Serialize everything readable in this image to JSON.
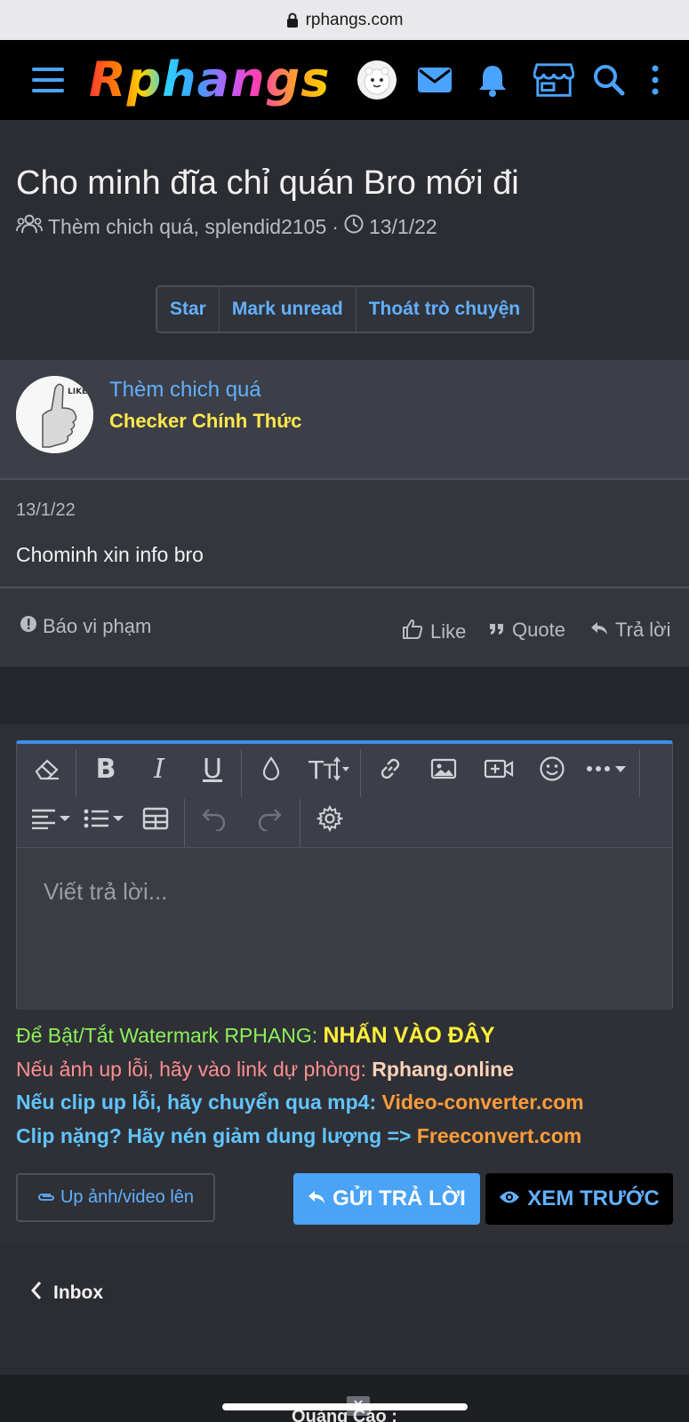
{
  "browser": {
    "url": "rphangs.com"
  },
  "header": {
    "logo_text": "Rphangs",
    "icons": [
      "menu-icon",
      "avatar",
      "mail-icon",
      "bell-icon",
      "store-icon",
      "search-icon",
      "more-vertical-icon"
    ],
    "accent_color": "#4aa3ff"
  },
  "thread": {
    "title": "Cho minh đĩa chỉ quán Bro mới đi",
    "participants": "Thèm chich quá, splendid2105",
    "separator": "·",
    "date": "13/1/22",
    "buttons": {
      "star": "Star",
      "mark_unread": "Mark unread",
      "leave": "Thoát trò chuyện"
    }
  },
  "post": {
    "username": "Thèm chich quá",
    "user_title": "Checker Chính Thức",
    "avatar_text": "LIKE",
    "date": "13/1/22",
    "body": "Chominh xin info bro",
    "report": "Báo vi phạm",
    "like": "Like",
    "quote": "Quote",
    "reply": "Trả lời"
  },
  "editor": {
    "placeholder": "Viết trả lời...",
    "toolbar_row1": [
      "eraser-icon",
      "bold-icon",
      "italic-icon",
      "underline-icon",
      "color-drop-icon",
      "text-size-icon",
      "link-icon",
      "image-icon",
      "video-icon",
      "smiley-icon",
      "more-icon"
    ],
    "toolbar_row2": [
      "align-icon",
      "list-icon",
      "table-icon",
      "undo-icon",
      "redo-icon",
      "settings-icon"
    ]
  },
  "notes": {
    "line1_text": "Để Bật/Tắt Watermark RPHANG: ",
    "line1_link": "NHẤN VÀO ĐÂY",
    "line2_text": "Nếu ảnh up lỗi, hãy vào link dự phòng: ",
    "line2_link": "Rphang.online",
    "line3_text": "Nếu clip up lỗi, hãy chuyển qua mp4: ",
    "line3_link": "Video-converter.com",
    "line4_text": "Clip nặng? Hãy nén giảm dung lượng => ",
    "line4_link": "Freeconvert.com"
  },
  "actions": {
    "upload": "Up ảnh/video lên",
    "send": "GỬI TRẢ LỜI",
    "preview": "XEM TRƯỚC"
  },
  "nav": {
    "inbox": "Inbox"
  },
  "footer": {
    "ads_label": "Quảng Cáo :"
  }
}
